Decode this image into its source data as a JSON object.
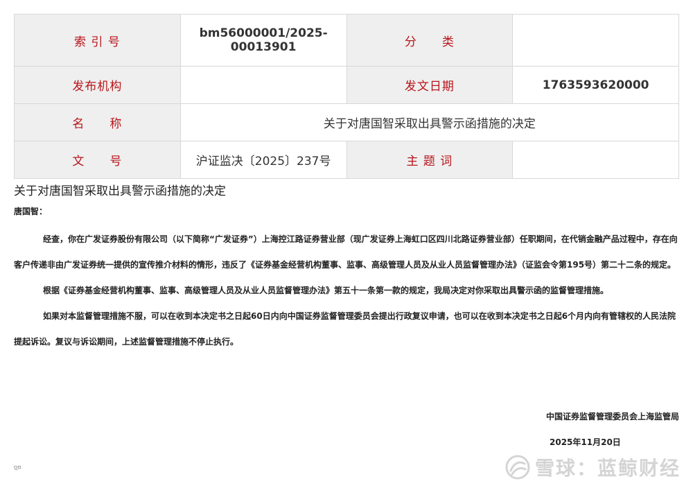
{
  "meta_table": {
    "index_label": "索 引 号",
    "index_value": "bm56000001/2025-00013901",
    "category_label": "分　　类",
    "category_value": "",
    "publisher_label": "发布机构",
    "publisher_value": "",
    "date_label": "发文日期",
    "date_value": "1763593620000",
    "name_label": "名　　称",
    "name_value": "关于对唐国智采取出具警示函措施的决定",
    "doc_no_label": "文　　号",
    "doc_no_value": "沪证监决〔2025〕237号",
    "keywords_label": "主 题 词",
    "keywords_value": ""
  },
  "document": {
    "title": "关于对唐国智采取出具警示函措施的决定",
    "salutation": "唐国智：",
    "paragraphs": [
      "经查，你在广发证券股份有限公司（以下简称“广发证券”）上海控江路证券营业部（现广发证券上海虹口区四川北路证券营业部）任职期间，在代销金融产品过程中，存在向客户传递非由广发证券统一提供的宣传推介材料的情形，违反了《证券基金经营机构董事、监事、高级管理人员及从业人员监督管理办法》（证监会令第195号）第二十二条的规定。",
      "根据《证券基金经营机构董事、监事、高级管理人员及从业人员监督管理办法》第五十一条第一款的规定，我局决定对你采取出具警示函的监督管理措施。",
      "如果对本监督管理措施不服，可以在收到本决定书之日起60日内向中国证券监督管理委员会提出行政复议申请，也可以在收到本决定书之日起6个月内向有管辖权的人民法院提起诉讼。复议与诉讼期间，上述监督管理措施不停止执行。"
    ],
    "signature_org": "中国证券监督管理委员会上海监管局",
    "signature_date": "2025年11月20日",
    "footer_mark": "▫̲▫"
  },
  "watermark": {
    "icon": "snowball-logo-icon",
    "text": "雪球：蓝鲸财经",
    "color": "#d4d4d4"
  },
  "colors": {
    "label_text": "#b8141a",
    "label_bg": "#efefef",
    "border": "#d8d8d8"
  }
}
